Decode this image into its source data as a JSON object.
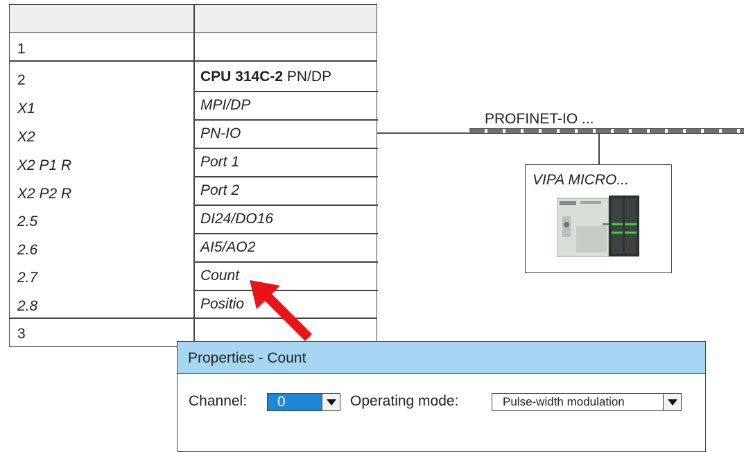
{
  "config_table": {
    "rows": [
      {
        "slot": "1",
        "module": ""
      },
      {
        "slot": "2",
        "module_bold": "CPU 314C-2",
        "module_rest": " PN/DP"
      },
      {
        "slot": "X1",
        "module": "MPI/DP"
      },
      {
        "slot": "X2",
        "module": "PN-IO"
      },
      {
        "slot": "X2 P1 R",
        "module": "Port 1"
      },
      {
        "slot": "X2 P2 R",
        "module": "Port 2"
      },
      {
        "slot": "2.5",
        "module": "DI24/DO16"
      },
      {
        "slot": "2.6",
        "module": "AI5/AO2"
      },
      {
        "slot": "2.7",
        "module": "Count"
      },
      {
        "slot": "2.8",
        "module": "Positio"
      },
      {
        "slot": "3",
        "module": ""
      }
    ]
  },
  "network": {
    "label": "PROFINET-IO ...",
    "device_title": "VIPA MICRO..."
  },
  "properties": {
    "title": "Properties - Count",
    "channel_label": "Channel:",
    "channel_value": "0",
    "mode_label": "Operating mode:",
    "mode_value": "Pulse-width modulation"
  },
  "colors": {
    "title_bar": "#a7d6f2",
    "channel_select": "#1e88d6",
    "arrow": "#e8141a"
  },
  "icons": [
    "dropdown-arrow-icon",
    "red-pointer-arrow",
    "vipa-micro-device-image"
  ]
}
